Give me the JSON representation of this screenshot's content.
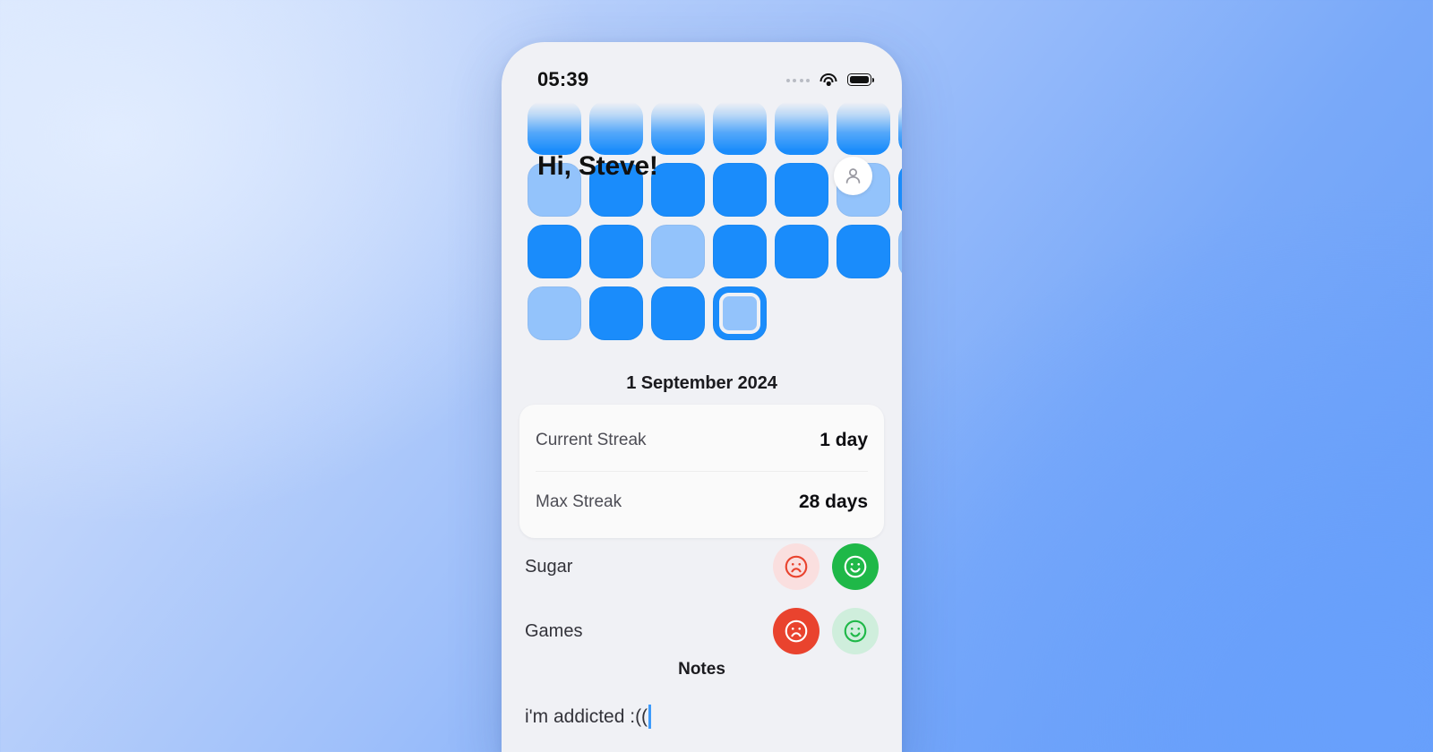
{
  "background": {
    "accent_light": "#d7e5fc",
    "accent_dark": "#629bf8"
  },
  "phone": {
    "screen_bg": "#f0f1f5",
    "status_bar": {
      "time": "05:39",
      "cellular_icon": "signal-dots-icon",
      "wifi_icon": "wifi-icon",
      "battery_icon": "battery-full-icon"
    }
  },
  "header": {
    "greeting": "Hi, Steve!",
    "avatar_icon": "person-avatar-icon"
  },
  "calendar": {
    "cell_color_filled": "#1a8cfb",
    "cell_color_light": "#93c3fb",
    "selected_ring_color": "#1a8cfb",
    "rows": [
      {
        "faded": true,
        "cells": [
          "filled",
          "filled",
          "filled",
          "filled",
          "filled",
          "filled",
          "filled"
        ]
      },
      {
        "faded": false,
        "cells": [
          "light",
          "filled",
          "filled",
          "filled",
          "filled",
          "light",
          "filled"
        ]
      },
      {
        "faded": false,
        "cells": [
          "filled",
          "filled",
          "light",
          "filled",
          "filled",
          "filled",
          "light"
        ]
      },
      {
        "faded": false,
        "cells": [
          "light",
          "filled",
          "filled",
          "selected",
          "empty",
          "empty",
          "empty"
        ]
      }
    ]
  },
  "date_label": "1 September 2024",
  "stats": {
    "rows": [
      {
        "label": "Current Streak",
        "value": "1 day"
      },
      {
        "label": "Max Streak",
        "value": "28 days"
      }
    ]
  },
  "habits": {
    "items": [
      {
        "name": "Sugar",
        "sad_icon": "frowning-face-icon",
        "happy_icon": "smiling-face-icon",
        "sad_state": "inactive",
        "happy_state": "active"
      },
      {
        "name": "Games",
        "sad_icon": "frowning-face-icon",
        "happy_icon": "smiling-face-icon",
        "sad_state": "active",
        "happy_state": "inactive"
      }
    ],
    "colors": {
      "sad_active_bg": "#e9432e",
      "sad_inactive_bg": "#fadfdf",
      "sad_inactive_fg": "#e9432e",
      "happy_active_bg": "#1fb848",
      "happy_inactive_bg": "#cfeedc",
      "happy_inactive_fg": "#1fb848"
    }
  },
  "notes": {
    "title": "Notes",
    "value": "i'm addicted :((",
    "caret_color": "#3e9bfb"
  }
}
